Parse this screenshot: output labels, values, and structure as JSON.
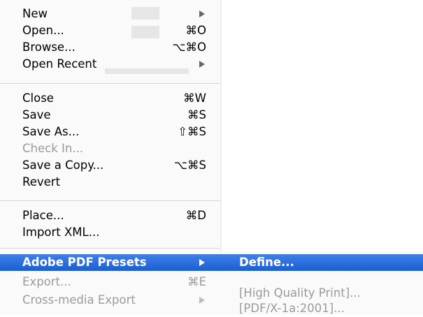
{
  "menu": {
    "items": [
      {
        "label": "New",
        "shortcut": ""
      },
      {
        "label": "Open...",
        "shortcut": "⌘O"
      },
      {
        "label": "Browse...",
        "shortcut": "⌥⌘O"
      },
      {
        "label": "Open Recent",
        "shortcut": ""
      },
      {
        "label": "Close",
        "shortcut": "⌘W"
      },
      {
        "label": "Save",
        "shortcut": "⌘S"
      },
      {
        "label": "Save As...",
        "shortcut": "⇧⌘S"
      },
      {
        "label": "Check In...",
        "shortcut": ""
      },
      {
        "label": "Save a Copy...",
        "shortcut": "⌥⌘S"
      },
      {
        "label": "Revert",
        "shortcut": ""
      },
      {
        "label": "Place...",
        "shortcut": "⌘D"
      },
      {
        "label": "Import XML...",
        "shortcut": ""
      },
      {
        "label": "Adobe PDF Presets",
        "shortcut": ""
      },
      {
        "label": "Export...",
        "shortcut": "⌘E"
      },
      {
        "label": "Cross-media Export",
        "shortcut": ""
      }
    ]
  },
  "submenu": {
    "items": [
      {
        "label": "Define..."
      },
      {
        "label": "[High Quality Print]..."
      },
      {
        "label": "[PDF/X-1a:2001]..."
      }
    ]
  },
  "colors": {
    "selection": "#1a5fd3",
    "disabled_text": "#9a9a9a",
    "menu_background": "#fafafa"
  }
}
